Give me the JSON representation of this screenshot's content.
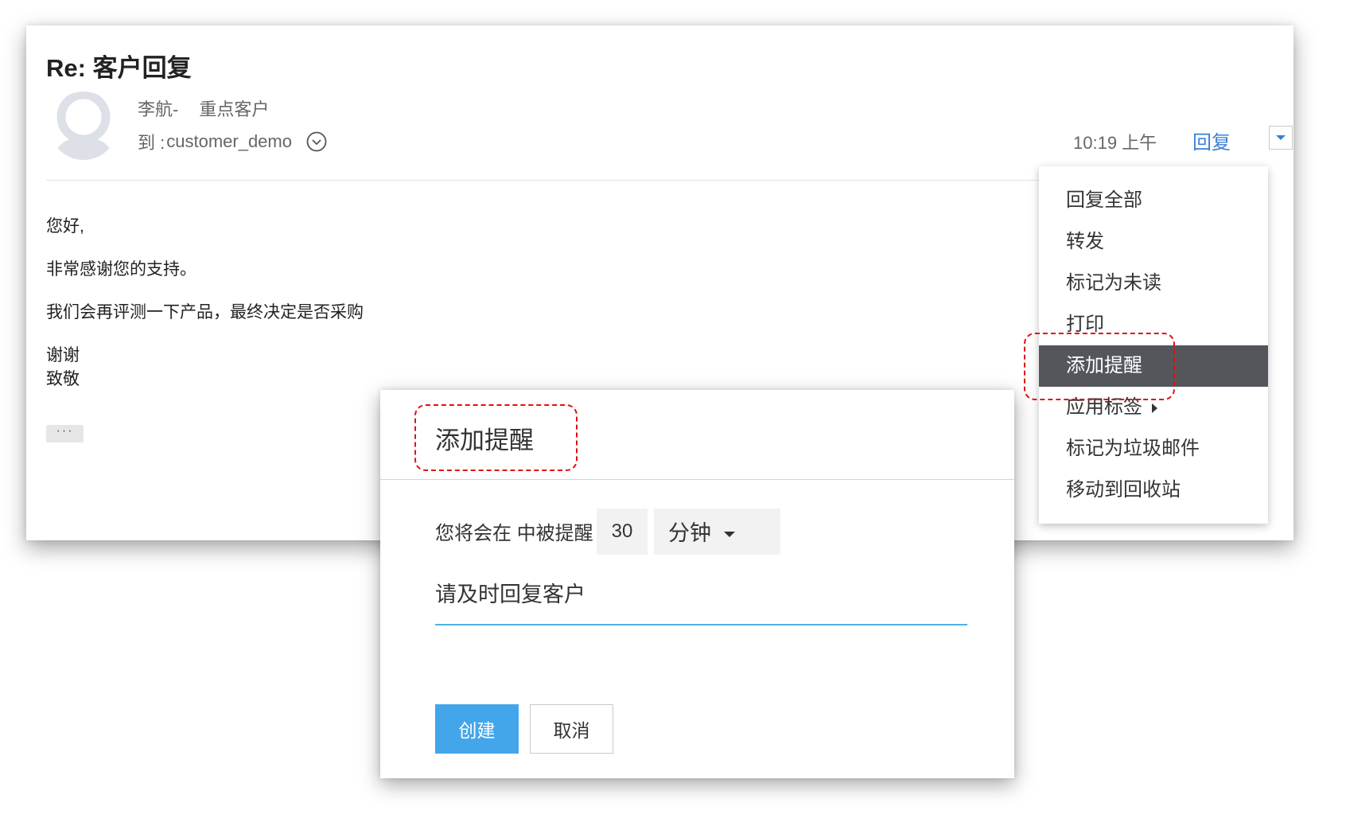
{
  "email": {
    "subject": "Re: 客户回复",
    "sender_name": "李航-",
    "sender_tag": "重点客户",
    "to_label": "到 : ",
    "to_address": "customer_demo",
    "time": "10:19 上午",
    "reply_label": "回复",
    "body": {
      "greeting": "您好,",
      "line1": "非常感谢您的支持。",
      "line2": "我们会再评测一下产品，最终决定是否采购",
      "closing1": "谢谢",
      "closing2": "致敬"
    },
    "ellipsis": "···"
  },
  "reply_menu": {
    "items": [
      {
        "label": "回复全部"
      },
      {
        "label": "转发"
      },
      {
        "label": "标记为未读"
      },
      {
        "label": "打印"
      },
      {
        "label": "添加提醒",
        "active": true
      },
      {
        "label": "应用标签",
        "has_submenu": true
      },
      {
        "label": "标记为垃圾邮件"
      },
      {
        "label": "移动到回收站"
      }
    ]
  },
  "reminder_dialog": {
    "title": "添加提醒",
    "remind_label": "您将会在 中被提醒",
    "amount": "30",
    "unit": "分钟",
    "note": "请及时回复客户",
    "create_label": "创建",
    "cancel_label": "取消"
  },
  "colors": {
    "link": "#3a7fd5",
    "menu_active_bg": "#54565c",
    "primary_button": "#44a6ea",
    "highlight": "#e01010",
    "input_underline": "#4fb0e8"
  },
  "icons": {
    "expand": "chevron-down-circle-icon",
    "reply_more": "caret-down-icon",
    "submenu": "caret-right-icon",
    "unit_dropdown": "caret-down-icon"
  }
}
